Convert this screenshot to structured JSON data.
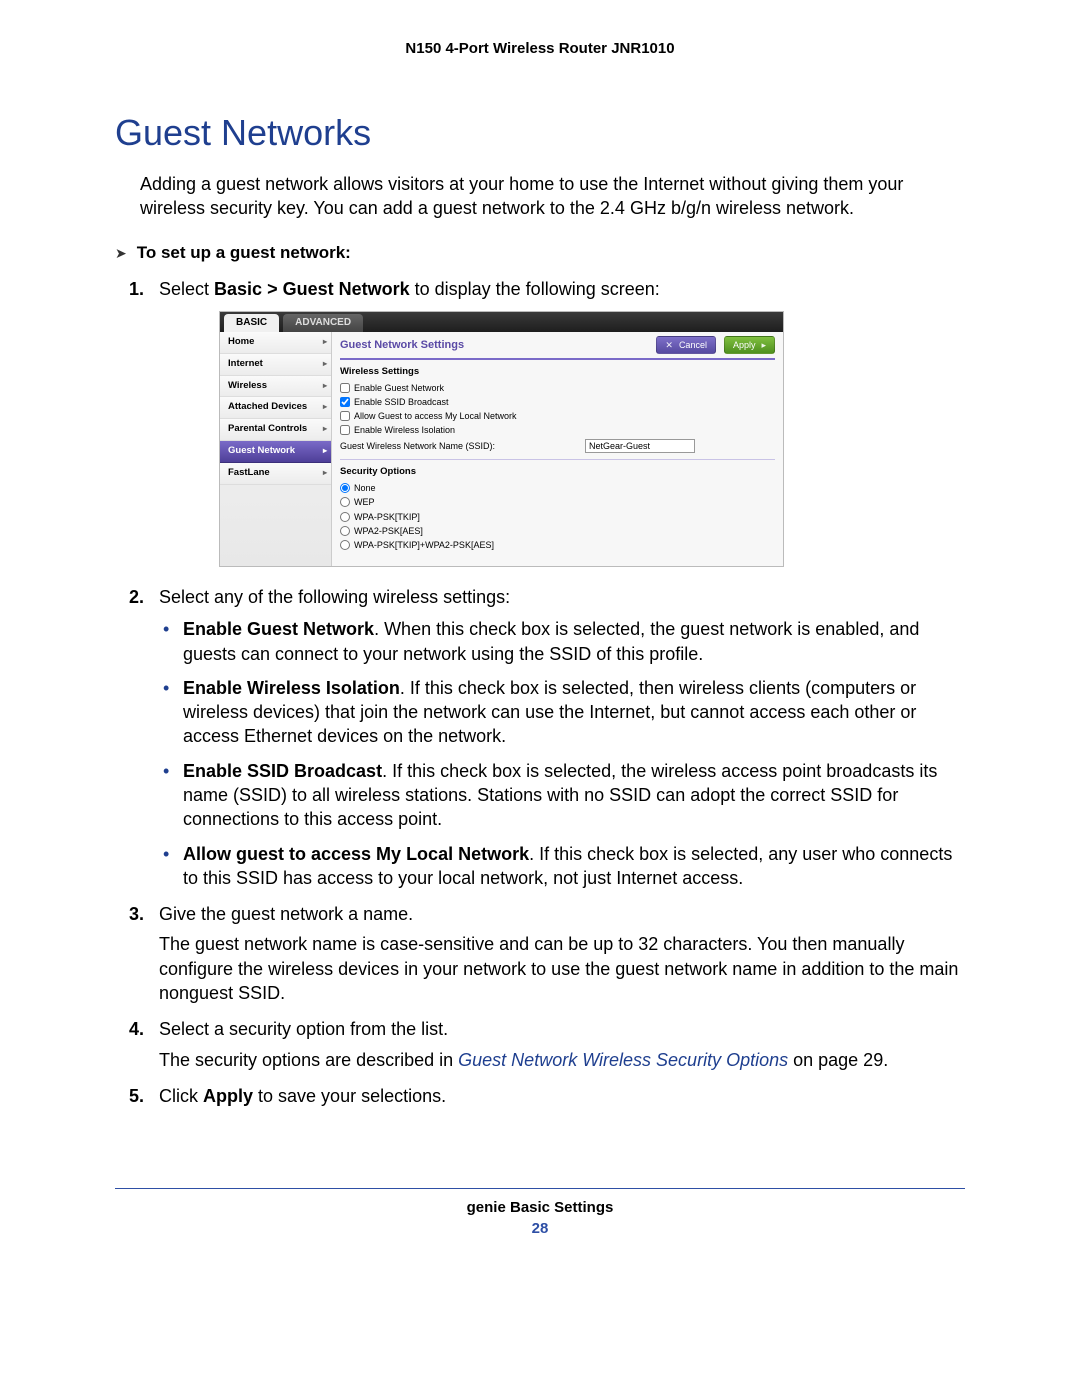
{
  "header": {
    "doc_title": "N150 4-Port Wireless Router JNR1010"
  },
  "heading": "Guest Networks",
  "intro": "Adding a guest network allows visitors at your home to use the Internet without giving them your wireless security key. You can add a guest network to the 2.4 GHz b/g/n wireless network.",
  "procedure_title": "To set up a guest network:",
  "steps": {
    "s1": {
      "num": "1.",
      "pre": "Select ",
      "bold": "Basic > Guest Network",
      "post": " to display the following screen:"
    },
    "s2": {
      "num": "2.",
      "text": "Select any of the following wireless settings:",
      "bullets": {
        "b1": {
          "bold": "Enable Guest Network",
          "rest": ". When this check box is selected, the guest network is enabled, and guests can connect to your network using the SSID of this profile."
        },
        "b2": {
          "bold": "Enable Wireless Isolation",
          "rest": ". If this check box is selected, then wireless clients (computers or wireless devices) that join the network can use the Internet, but cannot access each other or access Ethernet devices on the network."
        },
        "b3": {
          "bold": "Enable SSID Broadcast",
          "rest": ". If this check box is selected, the wireless access point broadcasts its name (SSID) to all wireless stations. Stations with no SSID can adopt the correct SSID for connections to this access point."
        },
        "b4": {
          "bold": "Allow guest to access My Local Network",
          "rest": ". If this check box is selected, any user who connects to this SSID has access to your local network, not just Internet access."
        }
      }
    },
    "s3": {
      "num": "3.",
      "line1": "Give the guest network a name.",
      "line2": "The guest network name is case-sensitive and can be up to 32 characters. You then manually configure the wireless devices in your network to use the guest network name in addition to the main nonguest SSID."
    },
    "s4": {
      "num": "4.",
      "line1": "Select a security option from the list.",
      "line2_pre": "The security options are described in ",
      "line2_link": "Guest Network Wireless Security Options",
      "line2_post": " on page 29."
    },
    "s5": {
      "num": "5.",
      "pre": "Click ",
      "bold": "Apply",
      "post": " to save your selections."
    }
  },
  "router_ui": {
    "tabs": {
      "basic": "BASIC",
      "advanced": "ADVANCED"
    },
    "sidebar": {
      "home": "Home",
      "internet": "Internet",
      "wireless": "Wireless",
      "attached": "Attached Devices",
      "parental": "Parental Controls",
      "guest": "Guest Network",
      "fastlane": "FastLane"
    },
    "pane_title": "Guest Network Settings",
    "buttons": {
      "cancel": "Cancel",
      "apply": "Apply"
    },
    "wireless_section": {
      "title": "Wireless Settings",
      "enable_guest": "Enable Guest Network",
      "enable_ssid": "Enable SSID Broadcast",
      "allow_local": "Allow Guest to access My Local Network",
      "enable_iso": "Enable Wireless Isolation",
      "ssid_label": "Guest Wireless Network Name (SSID):",
      "ssid_value": "NetGear-Guest"
    },
    "security_section": {
      "title": "Security Options",
      "none": "None",
      "wep": "WEP",
      "wpa_tkip": "WPA-PSK[TKIP]",
      "wpa2_aes": "WPA2-PSK[AES]",
      "wpa_mixed": "WPA-PSK[TKIP]+WPA2-PSK[AES]"
    }
  },
  "footer": {
    "section": "genie Basic Settings",
    "page": "28"
  }
}
